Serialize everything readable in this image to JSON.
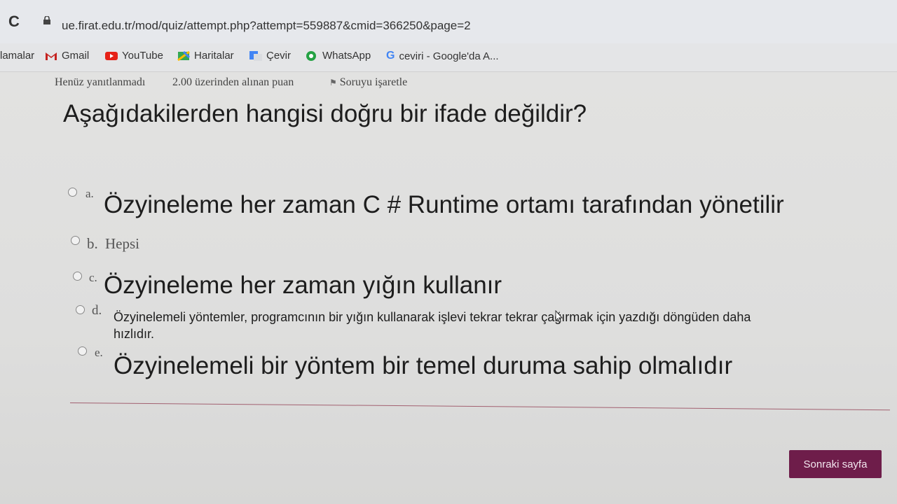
{
  "browser": {
    "url": "ue.firat.edu.tr/mod/quiz/attempt.php?attempt=559887&cmid=366250&page=2",
    "bookmarks": [
      {
        "label": "lamalar",
        "icon": "none"
      },
      {
        "label": "Gmail",
        "icon": "gmail-icon"
      },
      {
        "label": "YouTube",
        "icon": "youtube-icon"
      },
      {
        "label": "Haritalar",
        "icon": "maps-icon"
      },
      {
        "label": "Çevir",
        "icon": "translate-icon"
      },
      {
        "label": "WhatsApp",
        "icon": "whatsapp-icon"
      },
      {
        "label": "ceviri - Google'da A...",
        "icon": "google-icon"
      }
    ]
  },
  "question": {
    "status": "Henüz yanıtlanmadı",
    "points": "2.00 üzerinden alınan puan",
    "flag_label": "Soruyu işaretle",
    "text": "Aşağıdakilerden hangisi doğru bir ifade değildir?",
    "options": [
      {
        "letter": "a.",
        "text": "Özyineleme her zaman C # Runtime ortamı tarafından yönetilir"
      },
      {
        "letter": "b.",
        "text": "Hepsi"
      },
      {
        "letter": "c.",
        "text": "Özyineleme her zaman yığın kullanır"
      },
      {
        "letter": "d.",
        "text": "Özyinelemeli yöntemler, programcının bir yığın kullanarak işlevi tekrar tekrar çağırmak için yazdığı döngüden daha",
        "text_line2": "hızlıdır."
      },
      {
        "letter": "e.",
        "text": "Özyinelemeli bir yöntem bir temel duruma sahip olmalıdır"
      }
    ]
  },
  "navigation": {
    "next_label": "Sonraki sayfa"
  },
  "colors": {
    "accent": "#6e1d4a",
    "divider": "#a26070"
  }
}
